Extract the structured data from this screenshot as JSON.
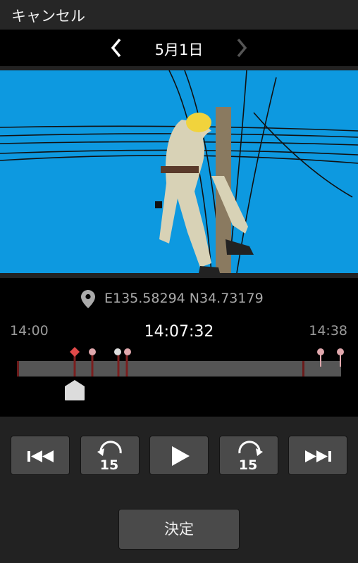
{
  "header": {
    "cancel_label": "キャンセル"
  },
  "date_nav": {
    "date_label": "5月1日"
  },
  "location": {
    "coordinates": "E135.58294  N34.73179"
  },
  "timeline": {
    "start_time": "14:00",
    "current_time": "14:07:32",
    "end_time": "14:38",
    "markers": [
      "14:07:32",
      "14:09",
      "14:12",
      "14:12:30",
      "14:34",
      "14:37:30"
    ]
  },
  "playback": {
    "buttons": [
      "skip-previous",
      "replay-15",
      "play",
      "forward-15",
      "skip-next"
    ],
    "skip_seconds": "15"
  },
  "footer": {
    "confirm_label": "決定"
  },
  "colors": {
    "sky": "#0d99e0",
    "selected_marker": "#e24a4a",
    "marker": "#e0a8ad",
    "track": "#555555"
  }
}
